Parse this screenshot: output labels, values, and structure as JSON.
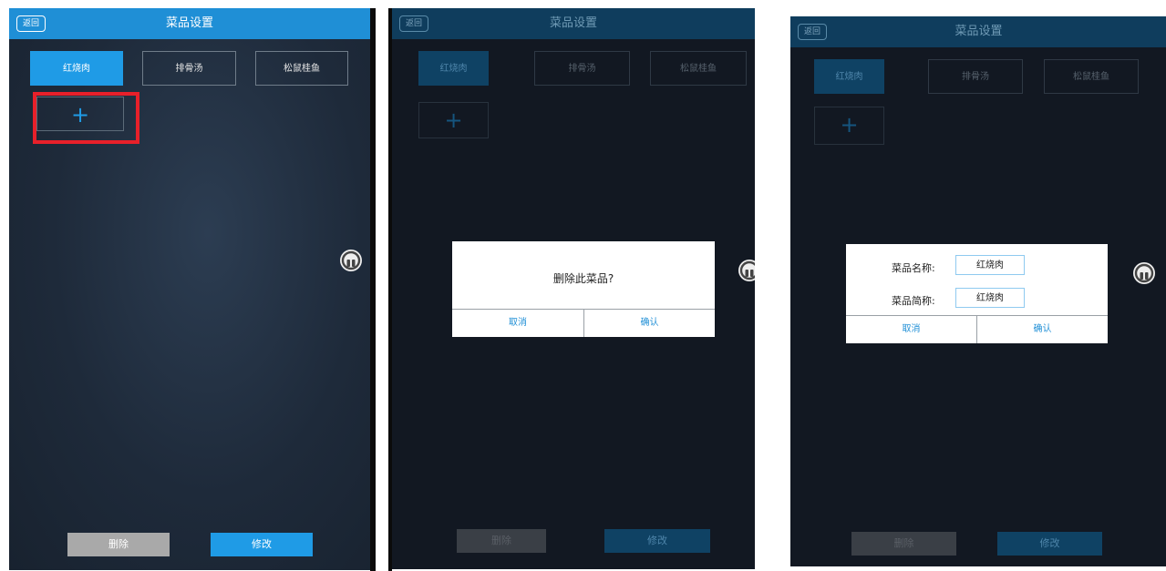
{
  "header": {
    "back_label": "返回",
    "title": "菜品设置"
  },
  "tabs": [
    {
      "label": "红烧肉"
    },
    {
      "label": "排骨汤"
    },
    {
      "label": "松鼠桂鱼"
    }
  ],
  "add_button": {
    "icon": "+"
  },
  "footer": {
    "delete_label": "删除",
    "modify_label": "修改"
  },
  "delete_dialog": {
    "message": "删除此菜品?",
    "cancel_label": "取消",
    "confirm_label": "确认"
  },
  "edit_dialog": {
    "name_label": "菜品名称:",
    "name_value": "红烧肉",
    "short_label": "菜品简称:",
    "short_value": "红烧肉",
    "cancel_label": "取消",
    "confirm_label": "确认"
  },
  "colors": {
    "accent": "#1f9be6",
    "highlight": "#e8202a",
    "background": "#1e2a3a"
  }
}
